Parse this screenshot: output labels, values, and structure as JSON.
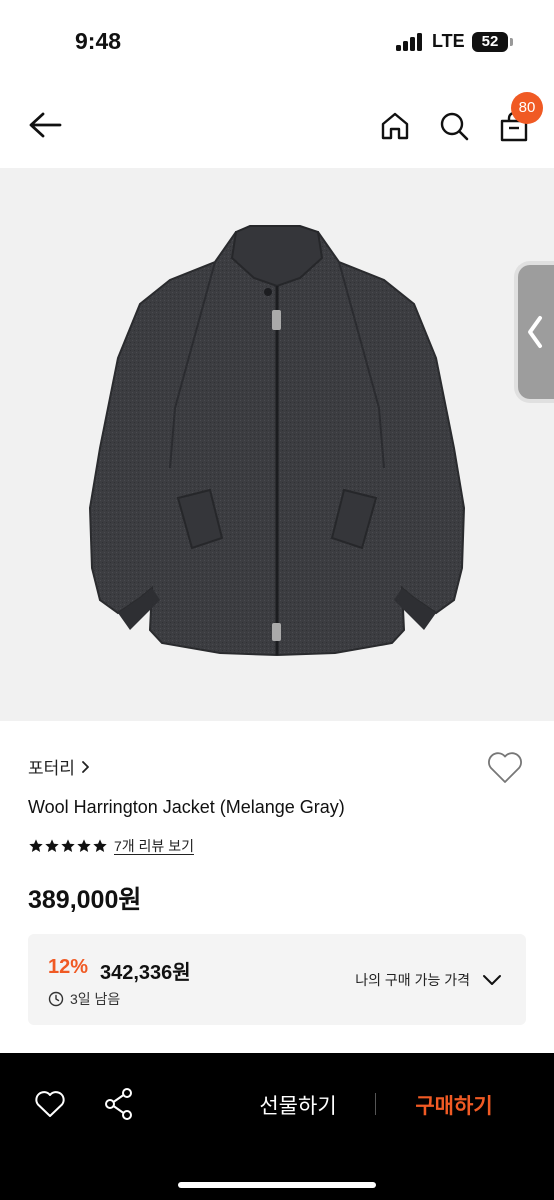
{
  "status_bar": {
    "time": "9:48",
    "network": "LTE",
    "battery": "52"
  },
  "nav": {
    "cart_badge": "80",
    "icons": [
      "back-arrow-icon",
      "home-icon",
      "search-icon",
      "shopping-bag-icon"
    ]
  },
  "product": {
    "image_description_icon": "jacket-photo",
    "brand": "포터리",
    "brand_chevron": "›",
    "title": "Wool Harrington Jacket (Melange Gray)",
    "rating_stars": 5,
    "review_link": "7개 리뷰 보기",
    "price": "389,000원"
  },
  "deal": {
    "percent": "12%",
    "price": "342,336원",
    "timer": "3일 남음",
    "dropdown_label": "나의 구매 가능 가격"
  },
  "bottom_bar": {
    "gift_label": "선물하기",
    "buy_label": "구매하기"
  },
  "colors": {
    "accent": "#f05a24",
    "bottom_bar": "#000000",
    "deal_bg": "#f4f4f4"
  }
}
